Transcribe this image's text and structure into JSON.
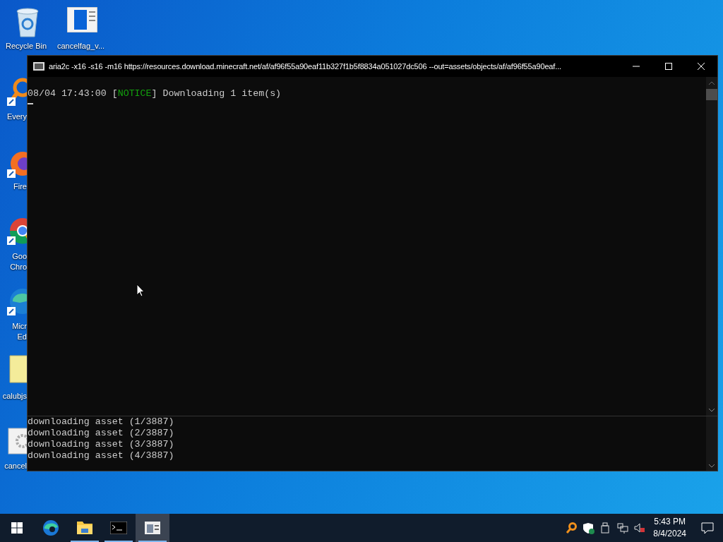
{
  "desktop_icons": [
    {
      "kind": "recycle",
      "label": "Recycle Bin"
    },
    {
      "kind": "document",
      "label": "cancelfag_v..."
    },
    {
      "kind": "magnifier",
      "label": "Every"
    },
    {
      "kind": "firefox",
      "label": "Fire"
    },
    {
      "kind": "chrome",
      "label": "Goo\nChro"
    },
    {
      "kind": "edge",
      "label": "Micr\nEd"
    },
    {
      "kind": "folder",
      "label": "calubjs"
    },
    {
      "kind": "gear",
      "label": "cancel"
    }
  ],
  "window": {
    "title": "aria2c  -x16 -s16 -m16 https://resources.download.minecraft.net/af/af96f55a90eaf11b327f1b5f8834a051027dc506 --out=assets/objects/af/af96f55a90eaf...",
    "console_lines": [
      {
        "prefix": "08/04 17:43:00 [",
        "level": "NOTICE",
        "suffix": "] Downloading 1 item(s)"
      }
    ],
    "cursor_line": true,
    "log_lines": [
      "downloading asset (1/3887)",
      "downloading asset (2/3887)",
      "downloading asset (3/3887)",
      "downloading asset (4/3887)"
    ]
  },
  "taskbar": {
    "apps": [
      {
        "kind": "start",
        "running": false,
        "selected": false
      },
      {
        "kind": "edge",
        "running": false,
        "selected": false
      },
      {
        "kind": "explorer",
        "running": true,
        "selected": false
      },
      {
        "kind": "terminal",
        "running": true,
        "selected": false
      },
      {
        "kind": "window",
        "running": true,
        "selected": true
      }
    ],
    "time": "5:43 PM",
    "date": "8/4/2024"
  }
}
